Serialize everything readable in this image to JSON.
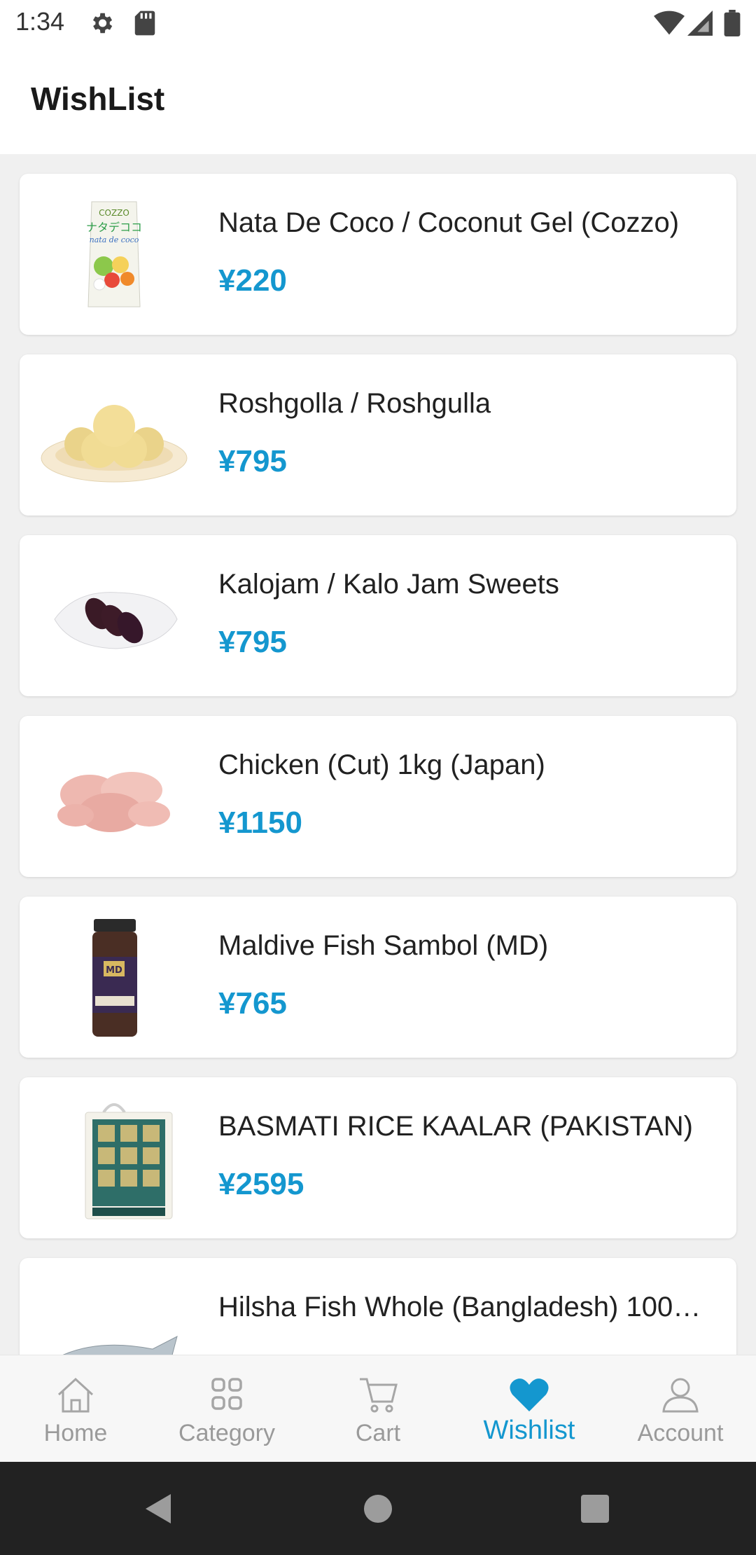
{
  "status_bar": {
    "time": "1:34"
  },
  "header": {
    "title": "WishList"
  },
  "wishlist": {
    "items": [
      {
        "name": "Nata De Coco / Coconut Gel (Cozzo)",
        "price": "¥220",
        "image": "coconut-gel-pack-image"
      },
      {
        "name": "Roshgolla / Roshgulla",
        "price": "¥795",
        "image": "roshgolla-plate-image"
      },
      {
        "name": "Kalojam / Kalo Jam Sweets",
        "price": "¥795",
        "image": "kalojam-plate-image"
      },
      {
        "name": "Chicken (Cut) 1kg (Japan)",
        "price": "¥1150",
        "image": "raw-chicken-image"
      },
      {
        "name": "Maldive Fish Sambol (MD)",
        "price": "¥765",
        "image": "sambol-jar-image"
      },
      {
        "name": "BASMATI RICE KAALAR (PAKISTAN)",
        "price": "¥2595",
        "image": "rice-bag-image"
      },
      {
        "name": "Hilsha Fish Whole (Bangladesh) 100…",
        "price": "",
        "image": "hilsha-fish-image"
      }
    ]
  },
  "bottom_nav": {
    "items": [
      {
        "label": "Home",
        "icon": "home-icon"
      },
      {
        "label": "Category",
        "icon": "category-grid-icon"
      },
      {
        "label": "Cart",
        "icon": "cart-icon"
      },
      {
        "label": "Wishlist",
        "icon": "heart-icon",
        "active": true
      },
      {
        "label": "Account",
        "icon": "person-icon"
      }
    ]
  },
  "colors": {
    "accent": "#1497cf",
    "inactive": "#9a9a9a",
    "background": "#f0f0f0"
  }
}
